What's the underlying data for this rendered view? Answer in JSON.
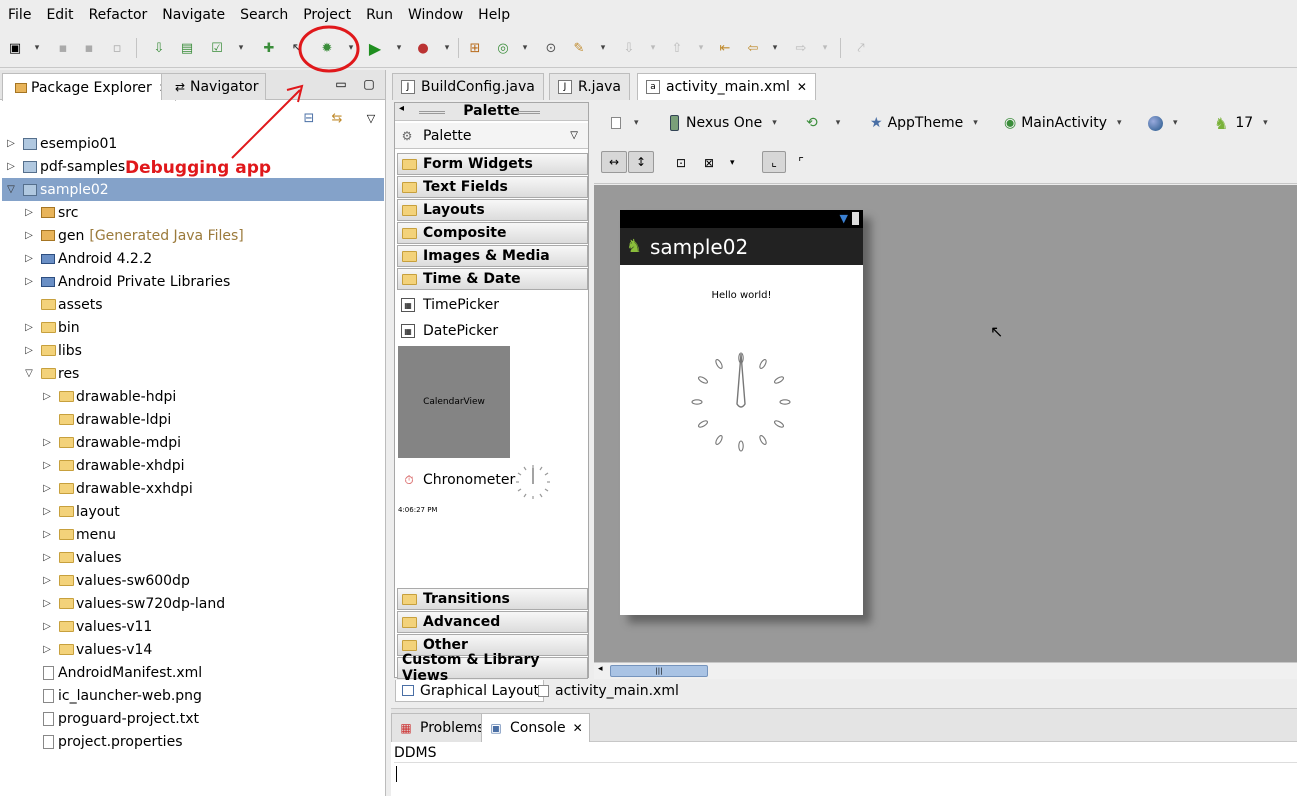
{
  "menu": [
    "File",
    "Edit",
    "Refactor",
    "Navigate",
    "Search",
    "Project",
    "Run",
    "Window",
    "Help"
  ],
  "left_panel": {
    "tabs": [
      {
        "label": "Package Explorer",
        "active": true
      },
      {
        "label": "Navigator",
        "active": false
      }
    ],
    "tree": [
      {
        "label": "esempio01",
        "depth": 0,
        "expand": "closed",
        "icon": "project-icon"
      },
      {
        "label": "pdf-samples",
        "depth": 0,
        "expand": "closed",
        "icon": "project-icon"
      },
      {
        "label": "sample02",
        "depth": 0,
        "expand": "open",
        "icon": "project-icon",
        "selected": true
      },
      {
        "label": "src",
        "depth": 1,
        "expand": "closed",
        "icon": "package-folder-icon"
      },
      {
        "label": "gen",
        "suffix": "[Generated Java Files]",
        "depth": 1,
        "expand": "closed",
        "icon": "package-folder-icon"
      },
      {
        "label": "Android 4.2.2",
        "depth": 1,
        "expand": "closed",
        "icon": "library-icon"
      },
      {
        "label": "Android Private Libraries",
        "depth": 1,
        "expand": "closed",
        "icon": "library-icon"
      },
      {
        "label": "assets",
        "depth": 1,
        "expand": "none",
        "icon": "folder-icon"
      },
      {
        "label": "bin",
        "depth": 1,
        "expand": "closed",
        "icon": "folder-icon"
      },
      {
        "label": "libs",
        "depth": 1,
        "expand": "closed",
        "icon": "folder-icon"
      },
      {
        "label": "res",
        "depth": 1,
        "expand": "open",
        "icon": "folder-icon"
      },
      {
        "label": "drawable-hdpi",
        "depth": 2,
        "expand": "closed",
        "icon": "folder-icon"
      },
      {
        "label": "drawable-ldpi",
        "depth": 2,
        "expand": "none",
        "icon": "folder-icon"
      },
      {
        "label": "drawable-mdpi",
        "depth": 2,
        "expand": "closed",
        "icon": "folder-icon"
      },
      {
        "label": "drawable-xhdpi",
        "depth": 2,
        "expand": "closed",
        "icon": "folder-icon"
      },
      {
        "label": "drawable-xxhdpi",
        "depth": 2,
        "expand": "closed",
        "icon": "folder-icon"
      },
      {
        "label": "layout",
        "depth": 2,
        "expand": "closed",
        "icon": "folder-icon"
      },
      {
        "label": "menu",
        "depth": 2,
        "expand": "closed",
        "icon": "folder-icon"
      },
      {
        "label": "values",
        "depth": 2,
        "expand": "closed",
        "icon": "folder-icon"
      },
      {
        "label": "values-sw600dp",
        "depth": 2,
        "expand": "closed",
        "icon": "folder-icon"
      },
      {
        "label": "values-sw720dp-land",
        "depth": 2,
        "expand": "closed",
        "icon": "folder-icon"
      },
      {
        "label": "values-v11",
        "depth": 2,
        "expand": "closed",
        "icon": "folder-icon"
      },
      {
        "label": "values-v14",
        "depth": 2,
        "expand": "closed",
        "icon": "folder-icon"
      },
      {
        "label": "AndroidManifest.xml",
        "depth": 1,
        "expand": "none",
        "icon": "xml-file-icon"
      },
      {
        "label": "ic_launcher-web.png",
        "depth": 1,
        "expand": "none",
        "icon": "image-file-icon"
      },
      {
        "label": "proguard-project.txt",
        "depth": 1,
        "expand": "none",
        "icon": "text-file-icon"
      },
      {
        "label": "project.properties",
        "depth": 1,
        "expand": "none",
        "icon": "text-file-icon"
      }
    ]
  },
  "annotation": {
    "text": "Debugging app",
    "color": "#e0181b"
  },
  "editor": {
    "tabs": [
      {
        "label": "BuildConfig.java",
        "active": false
      },
      {
        "label": "R.java",
        "active": false
      },
      {
        "label": "activity_main.xml",
        "active": true
      }
    ],
    "palette": {
      "header": "Palette",
      "dropdown": "Palette",
      "categories_top": [
        "Form Widgets",
        "Text Fields",
        "Layouts",
        "Composite",
        "Images & Media",
        "Time & Date"
      ],
      "items": [
        "TimePicker",
        "DatePicker"
      ],
      "calendar_label": "CalendarView",
      "chronometer_label": "Chronometer",
      "chronometer_time": "4:06:27 PM",
      "categories_bottom": [
        "Transitions",
        "Advanced",
        "Other",
        "Custom & Library Views"
      ]
    },
    "layout_toolbar": {
      "device": "Nexus One",
      "theme": "AppTheme",
      "activity": "MainActivity",
      "api": "17"
    },
    "preview": {
      "app_title": "sample02",
      "hello_text": "Hello world!"
    },
    "bottom_tabs": [
      {
        "label": "Graphical Layout",
        "active": true
      },
      {
        "label": "activity_main.xml",
        "active": false
      }
    ]
  },
  "console": {
    "tabs": [
      {
        "label": "Problems",
        "active": false
      },
      {
        "label": "Console",
        "active": true
      }
    ],
    "title": "DDMS"
  }
}
